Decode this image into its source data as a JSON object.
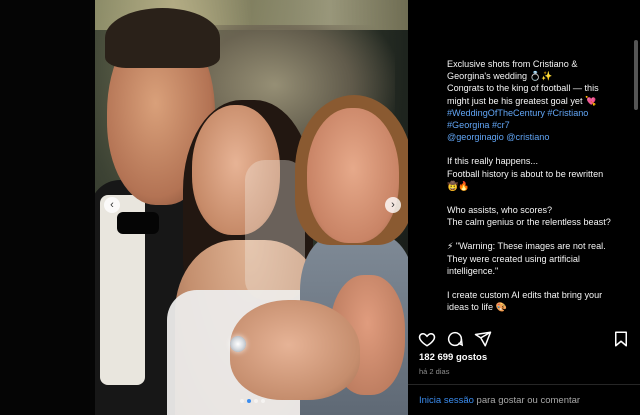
{
  "post": {
    "caption_lines": [
      "Exclusive shots from Cristiano &",
      "Georgina's wedding 💍✨",
      "Congrats to the king of football — this",
      "might just be his greatest goal yet 💘"
    ],
    "hashtags_line1": "#WeddingOfTheCentury #Cristiano",
    "hashtags_line2": "#Georgina #cr7",
    "mentions": "@georginagio @cristiano",
    "para2_line1": "If this really happens...",
    "para2_line2": "Football history is about to be rewritten",
    "para2_line3": "🤠🔥",
    "para3_line1": "Who assists, who scores?",
    "para3_line2": "The calm genius or the relentless beast?",
    "warning_line1": "⚡ \"Warning: These images are not real.",
    "warning_line2": "They were created using artificial",
    "warning_line3": "intelligence.\"",
    "cta_line1": "I create custom AI edits that bring your",
    "cta_line2": "ideas to life 🎨",
    "likes": "182 699 gostos",
    "time": "há 2 dias",
    "login_link": "Inicia sessão",
    "login_suffix": " para gostar ou comentar"
  },
  "carousel": {
    "prev_glyph": "‹",
    "next_glyph": "›",
    "slide_count": 4,
    "active_index": 1
  },
  "colors": {
    "link": "#61a5f5",
    "accent": "#3b8df0"
  },
  "icons": [
    "heart-icon",
    "comment-icon",
    "share-icon",
    "bookmark-icon"
  ]
}
